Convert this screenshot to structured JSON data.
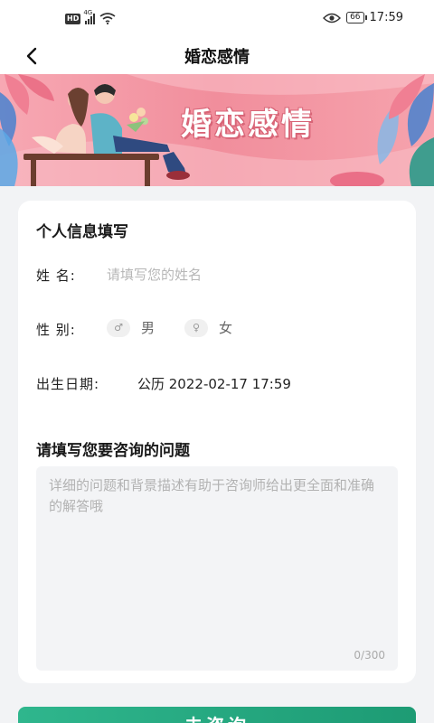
{
  "status_bar": {
    "hd": "HD",
    "network": "4G",
    "battery": "66",
    "time": "17:59"
  },
  "nav": {
    "title": "婚恋感情"
  },
  "banner": {
    "title": "婚恋感情"
  },
  "form": {
    "section_title": "个人信息填写",
    "name_label": "姓  名:",
    "name_placeholder": "请填写您的姓名",
    "gender_label": "性  别:",
    "gender_options": [
      {
        "icon": "male-icon",
        "label": "男"
      },
      {
        "icon": "female-icon",
        "label": "女"
      }
    ],
    "birth_label": "出生日期:",
    "birth_value": "公历  2022-02-17  17:59"
  },
  "question": {
    "title": "请填写您要咨询的问题",
    "placeholder": "详细的问题和背景描述有助于咨询师给出更全面和准确的解答哦",
    "counter": "0/300"
  },
  "submit": {
    "label": "去咨询"
  },
  "colors": {
    "accent": "#23a77f",
    "banner_pink": "#f18e9c",
    "background": "#f2f3f5"
  }
}
